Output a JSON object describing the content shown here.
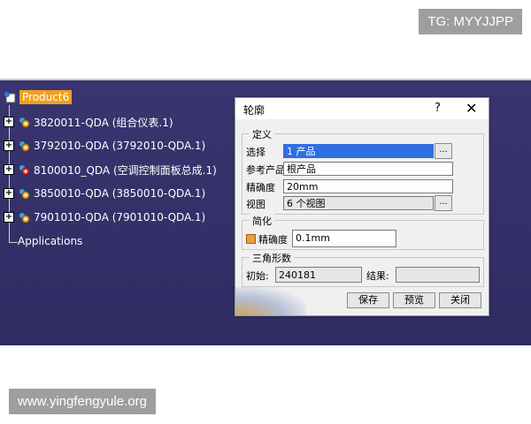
{
  "watermarks": {
    "top": "TG: MYYJJPP",
    "bottom": "www.yingfengyule.org"
  },
  "tree": {
    "root": "Product6",
    "items": [
      {
        "label": "3820011-QDA (组合仪表.1)"
      },
      {
        "label": "3792010-QDA (3792010-QDA.1)"
      },
      {
        "label": "8100010_QDA (空调控制面板总成.1)"
      },
      {
        "label": "3850010-QDA (3850010-QDA.1)"
      },
      {
        "label": "7901010-QDA (7901010-QDA.1)"
      }
    ],
    "applications": "Applications"
  },
  "dialog": {
    "title": "轮廓",
    "help": "?",
    "close": "✕",
    "definition": {
      "legend": "定义",
      "selection_label": "选择",
      "selection_value": "1 产品",
      "ref_product_label": "参考产品",
      "ref_product_value": "根产品",
      "accuracy_label": "精确度",
      "accuracy_value": "20mm",
      "view_label": "视图",
      "view_value": "6 个视图",
      "dots": "..."
    },
    "simplify": {
      "legend": "简化",
      "accuracy_label": "精确度",
      "accuracy_value": "0.1mm"
    },
    "triangles": {
      "legend": "三角形数",
      "initial_label": "初始:",
      "initial_value": "240181",
      "result_label": "结果:",
      "result_value": ""
    },
    "buttons": {
      "save": "保存",
      "preview": "预览",
      "close": "关闭"
    }
  }
}
